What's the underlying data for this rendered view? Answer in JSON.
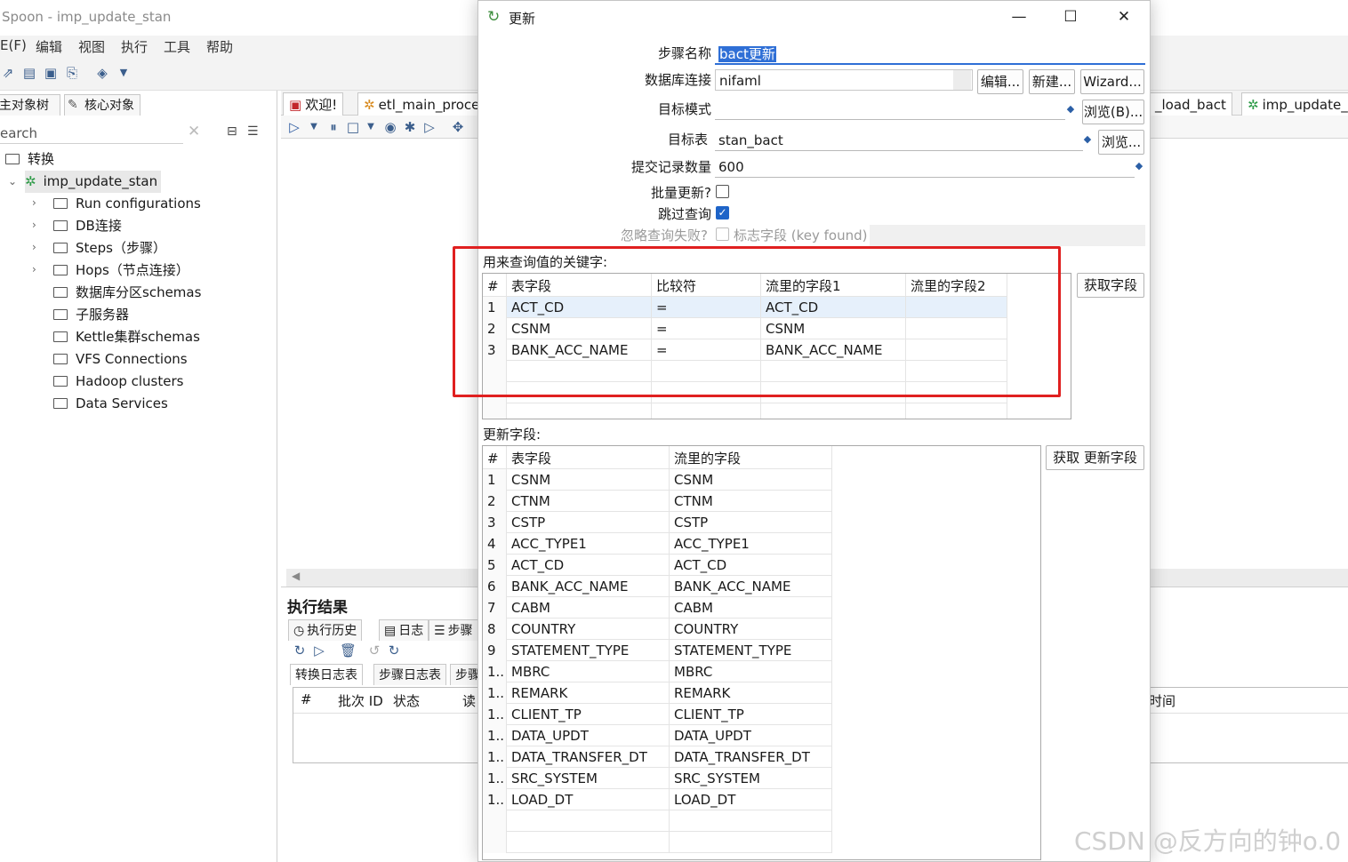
{
  "app": {
    "window_title": "Spoon - imp_update_stan",
    "menu": [
      "文件(F)",
      "编辑",
      "视图",
      "执行",
      "工具",
      "帮助"
    ],
    "menu_visible": [
      "E(F)",
      "编辑",
      "视图",
      "执行",
      "工具",
      "帮助"
    ]
  },
  "left_panel": {
    "tabs": [
      "主对象树",
      "核心对象"
    ],
    "tabs_visible": [
      "主对象树",
      "核心对象"
    ],
    "search_placeholder": "earch",
    "tree": {
      "root": "转换",
      "transform": "imp_update_stan",
      "children": [
        "Run configurations",
        "DB连接",
        "Steps（步骤）",
        "Hops（节点连接）",
        "数据库分区schemas",
        "子服务器",
        "Kettle集群schemas",
        "VFS Connections",
        "Hadoop clusters",
        "Data Services"
      ]
    }
  },
  "center": {
    "tabs": [
      "欢迎!",
      "etl_main_proce",
      "_load_bact",
      "imp_update_"
    ],
    "results_title": "执行结果",
    "result_tabs": [
      "执行历史",
      "日志",
      "步骤"
    ],
    "log_tabs": [
      "转换日志表",
      "步骤日志表",
      "步骤"
    ],
    "result_columns": [
      "#",
      "批次 ID",
      "状态",
      "读"
    ],
    "result_col_right": "时间"
  },
  "dialog": {
    "title": "更新",
    "step_name_label": "步骤名称",
    "step_name": "bact更新",
    "db_conn_label": "数据库连接",
    "db_conn": "nifaml",
    "btn_edit": "编辑...",
    "btn_new": "新建...",
    "btn_wizard": "Wizard...",
    "target_schema_label": "目标模式",
    "target_schema": "",
    "btn_browse_b": "浏览(B)...",
    "target_table_label": "目标表",
    "target_table": "stan_bact",
    "btn_browse": "浏览...",
    "commit_label": "提交记录数量",
    "commit": "600",
    "batch_update_label": "批量更新?",
    "batch_update": false,
    "skip_lookup_label": "跳过查询",
    "skip_lookup": true,
    "ignore_fail_label": "忽略查询失败?",
    "flag_field_label": "标志字段 (key found)",
    "key_section_label": "用来查询值的关键字:",
    "key_columns": [
      "#",
      "表字段",
      "比较符",
      "流里的字段1",
      "流里的字段2"
    ],
    "key_rows": [
      [
        "1",
        "ACT_CD",
        "=",
        "ACT_CD",
        ""
      ],
      [
        "2",
        "CSNM",
        "=",
        "CSNM",
        ""
      ],
      [
        "3",
        "BANK_ACC_NAME",
        "=",
        "BANK_ACC_NAME",
        ""
      ]
    ],
    "btn_get_fields": "获取字段",
    "update_section_label": "更新字段:",
    "update_columns": [
      "#",
      "表字段",
      "流里的字段"
    ],
    "update_rows": [
      [
        "1",
        "CSNM",
        "CSNM"
      ],
      [
        "2",
        "CTNM",
        "CTNM"
      ],
      [
        "3",
        "CSTP",
        "CSTP"
      ],
      [
        "4",
        "ACC_TYPE1",
        "ACC_TYPE1"
      ],
      [
        "5",
        "ACT_CD",
        "ACT_CD"
      ],
      [
        "6",
        "BANK_ACC_NAME",
        "BANK_ACC_NAME"
      ],
      [
        "7",
        "CABM",
        "CABM"
      ],
      [
        "8",
        "COUNTRY",
        "COUNTRY"
      ],
      [
        "9",
        "STATEMENT_TYPE",
        "STATEMENT_TYPE"
      ],
      [
        "1..",
        "MBRC",
        "MBRC"
      ],
      [
        "1..",
        "REMARK",
        "REMARK"
      ],
      [
        "1..",
        "CLIENT_TP",
        "CLIENT_TP"
      ],
      [
        "1..",
        "DATA_UPDT",
        "DATA_UPDT"
      ],
      [
        "1..",
        "DATA_TRANSFER_DT",
        "DATA_TRANSFER_DT"
      ],
      [
        "1..",
        "SRC_SYSTEM",
        "SRC_SYSTEM"
      ],
      [
        "1..",
        "LOAD_DT",
        "LOAD_DT"
      ]
    ],
    "btn_get_update_fields": "获取 更新字段"
  },
  "watermark": "CSDN @反方向的钟o.0",
  "colors": {
    "highlight_border": "#e02020",
    "selection_bg": "#2f6fd6",
    "checkbox_checked": "#1e64c8"
  }
}
